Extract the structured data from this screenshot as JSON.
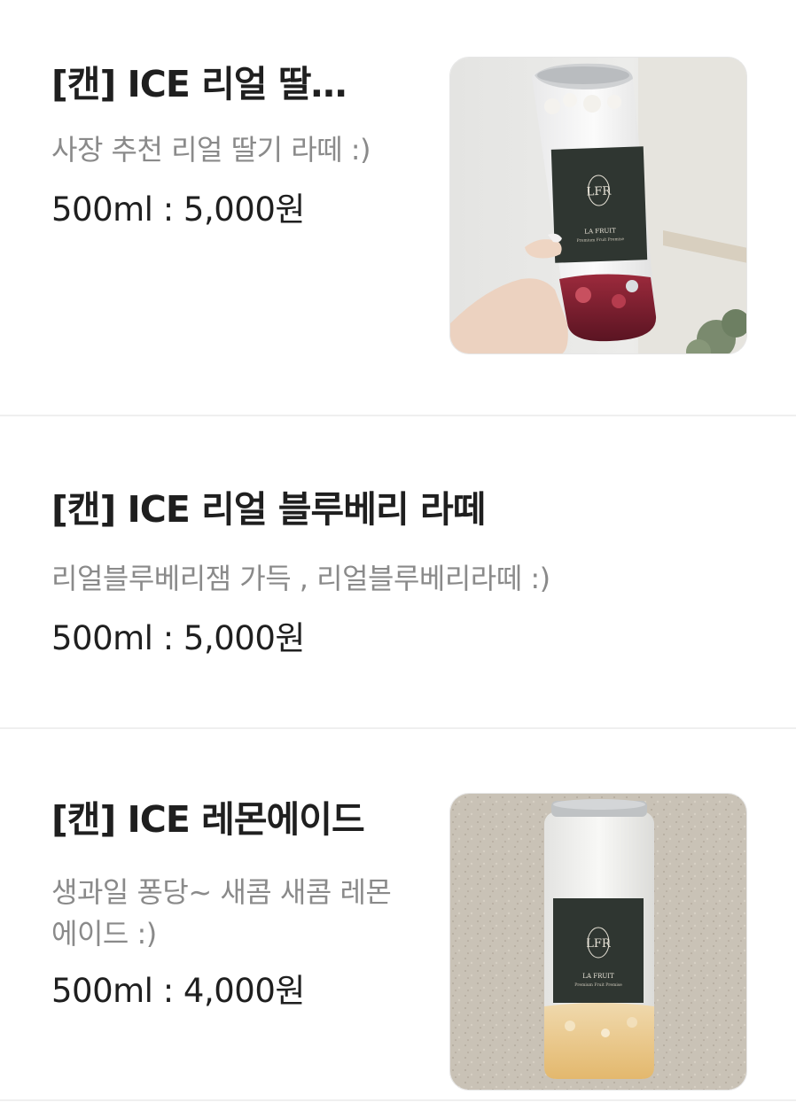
{
  "menu": {
    "items": [
      {
        "title": "[캔] ICE 리얼 딸…",
        "description": "사장 추천 리얼 딸기 라떼 :)",
        "price": "500ml : 5,000원",
        "has_image": true,
        "image_desc": "hand-holding-strawberry-latte-can"
      },
      {
        "title": "[캔] ICE 리얼 블루베리 라떼",
        "description": "리얼블루베리잼 가득 , 리얼블루베리라떼 :)",
        "price": "500ml : 5,000원",
        "has_image": false
      },
      {
        "title": "[캔] ICE 레몬에이드",
        "description": "생과일 퐁당~ 새콤 새콤 레몬에이드 :)",
        "price": "500ml : 4,000원",
        "has_image": true,
        "image_desc": "lemonade-can-on-stone-surface"
      }
    ]
  },
  "brand": {
    "label_monogram": "LFR",
    "label_name": "LA FRUIT",
    "label_tagline": "Premium Fruit Premise"
  },
  "colors": {
    "title": "#1f1f1f",
    "description": "#8a8a8a",
    "divider": "#efefef",
    "label_bg": "#2f3631"
  }
}
